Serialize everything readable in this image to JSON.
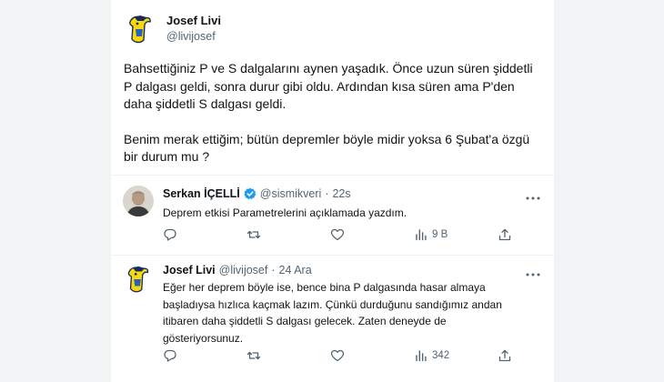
{
  "main_tweet": {
    "name": "Josef Livi",
    "handle": "@livijosef",
    "paragraph_1": "Bahsettiğiniz P ve S dalgalarını aynen yaşadık. Önce uzun süren şiddetli\nP dalgası geldi, sonra durur gibi oldu. Ardından kısa süren ama P'den\ndaha şiddetli S dalgası geldi.",
    "paragraph_2": "Benim merak ettiğim; bütün depremler böyle midir yoksa 6 Şubat'a özgü\nbir durum mu ?"
  },
  "reply_1": {
    "name": "Serkan İÇELLİ",
    "handle": "@sismikveri",
    "separator": "·",
    "time": "22s",
    "text": "Deprem etkisi Parametrelerini açıklamada yazdım.",
    "views": "9 B",
    "icons": [
      "reply-icon",
      "retweet-icon",
      "like-icon",
      "views-icon",
      "share-icon"
    ]
  },
  "reply_2": {
    "name": "Josef Livi",
    "handle": "@livijosef",
    "separator": "·",
    "time": "24 Ara",
    "text": "Eğer her deprem böyle ise, bence bina P dalgasında hasar almaya\nbaşladıysa hızlıca kaçmak lazım. Çünkü durduğunu sandığımız andan\nitibaren daha şiddetli S dalgası gelecek. Zaten deneyde de\ngösteriyorsunuz.",
    "views": "342",
    "icons": [
      "reply-icon",
      "retweet-icon",
      "like-icon",
      "views-icon",
      "share-icon"
    ]
  },
  "colors": {
    "text_primary": "#0f1419",
    "text_secondary": "#536471",
    "verified_blue": "#1d9bf0",
    "divider": "#eff3f4"
  }
}
